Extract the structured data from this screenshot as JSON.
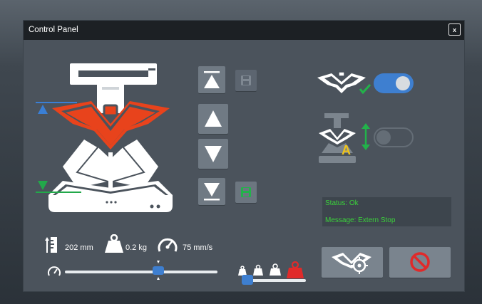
{
  "window": {
    "title": "Control Panel",
    "close_label": "x"
  },
  "icons": {
    "save": "save-icon",
    "up": "arrow-up-icon",
    "down": "arrow-down-icon",
    "top": "move-to-top-icon",
    "bottom": "move-to-bottom-icon"
  },
  "stats": {
    "height": "202 mm",
    "weight": "0.2 kg",
    "speed": "75 mm/s"
  },
  "speed_slider": {
    "value_fraction": 0.61
  },
  "weight_slider": {
    "value_fraction": 0.0
  },
  "toggles": {
    "auto_center": {
      "on": true
    },
    "auto_height": {
      "on": false
    }
  },
  "status": {
    "status_line": "Status: Ok",
    "message_line": "Message: Extern Stop"
  },
  "colors": {
    "accent_red": "#e8431c",
    "toggle_on": "#3e7fd0",
    "ok_green": "#3bd13b",
    "marker_blue": "#3a7fd5",
    "marker_green": "#22a84a",
    "stop_red": "#e02a2a",
    "auto_yellow": "#f0c419"
  }
}
